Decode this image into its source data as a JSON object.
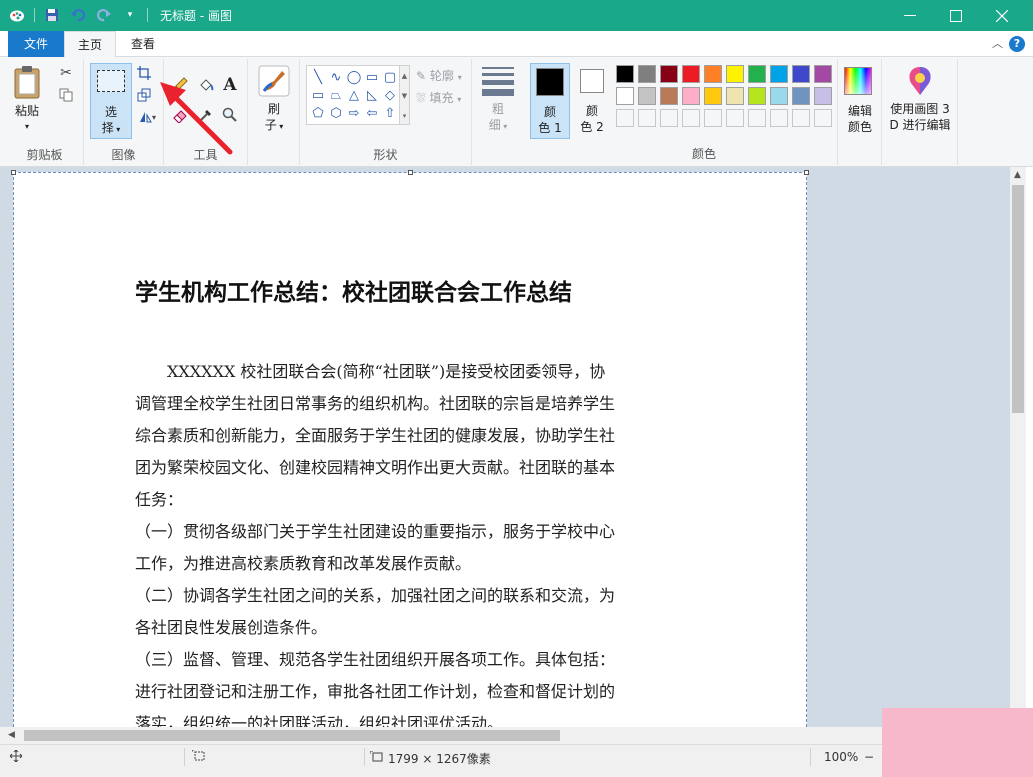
{
  "titlebar": {
    "title": "无标题 - 画图",
    "bg": "#1aa88b"
  },
  "tabs": {
    "file": "文件",
    "home": "主页",
    "view": "查看"
  },
  "ribbon": {
    "clipboard": {
      "paste": "粘贴",
      "label": "剪贴板"
    },
    "image": {
      "select_line1": "选",
      "select_line2": "择",
      "label": "图像"
    },
    "tools": {
      "label": "工具"
    },
    "brush": {
      "line1": "刷",
      "line2": "子"
    },
    "shapes": {
      "outline": "轮廓",
      "fill": "填充",
      "label": "形状"
    },
    "size": {
      "line1": "粗",
      "line2": "细"
    },
    "color1": {
      "line1": "颜",
      "line2": "色 1",
      "value": "#000000"
    },
    "color2": {
      "line1": "颜",
      "line2": "色 2",
      "value": "#ffffff"
    },
    "colors_label": "颜色",
    "edit_colors": {
      "line1": "编辑",
      "line2": "颜色"
    },
    "paint3d": {
      "line1": "使用画图 3",
      "line2": "D 进行编辑"
    },
    "palette_row1": [
      "#000000",
      "#7f7f7f",
      "#880015",
      "#ed1c24",
      "#ff7f27",
      "#fff200",
      "#22b14c",
      "#00a2e8",
      "#3f48cc",
      "#a349a4"
    ],
    "palette_row2": [
      "#ffffff",
      "#c3c3c3",
      "#b97a57",
      "#ffaec9",
      "#ffc90e",
      "#efe4b0",
      "#b5e61d",
      "#99d9ea",
      "#7092be",
      "#c8bfe7"
    ]
  },
  "document": {
    "title": "学生机构工作总结：校社团联合会工作总结",
    "lines": [
      "　　XXXXXX 校社团联合会(简称“社团联”)是接受校团委领导，协",
      "调管理全校学生社团日常事务的组织机构。社团联的宗旨是培养学生",
      "综合素质和创新能力，全面服务于学生社团的健康发展，协助学生社",
      "团为繁荣校园文化、创建校园精神文明作出更大贡献。社团联的基本",
      "任务：",
      "（一）贯彻各级部门关于学生社团建设的重要指示，服务于学校中心",
      "工作，为推进高校素质教育和改革发展作贡献。",
      "（二）协调各学生社团之间的关系，加强社团之间的联系和交流，为",
      "各社团良性发展创造条件。",
      "（三）监督、管理、规范各学生社团组织开展各项工作。具体包括：",
      "进行社团登记和注册工作，审批各社团工作计划，检查和督促计划的",
      "落实，组织统一的社团联活动，组织社团评优活动。"
    ]
  },
  "status": {
    "size": "1799 × 1267像素",
    "zoom": "100%"
  }
}
